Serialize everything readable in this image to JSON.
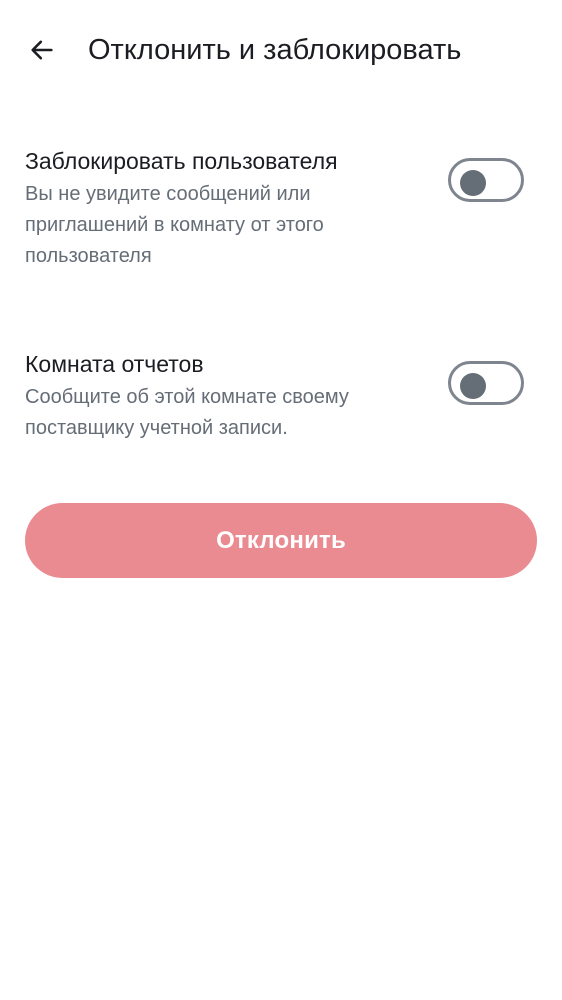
{
  "header": {
    "back_icon": "arrow-left-icon",
    "title": "Отклонить и заблокировать"
  },
  "settings": [
    {
      "title": "Заблокировать пользователя",
      "description": "Вы не увидите сообщений или приглашений в комнату от этого пользователя",
      "enabled": false
    },
    {
      "title": "Комната отчетов",
      "description": "Сообщите об этой комнате своему поставщику учетной записи.",
      "enabled": false
    }
  ],
  "actions": {
    "decline_label": "Отклонить"
  },
  "colors": {
    "primary_text": "#1b1d22",
    "secondary_text": "#656d77",
    "toggle_border": "#7e858f",
    "decline_button_bg": "#ea8b91"
  }
}
